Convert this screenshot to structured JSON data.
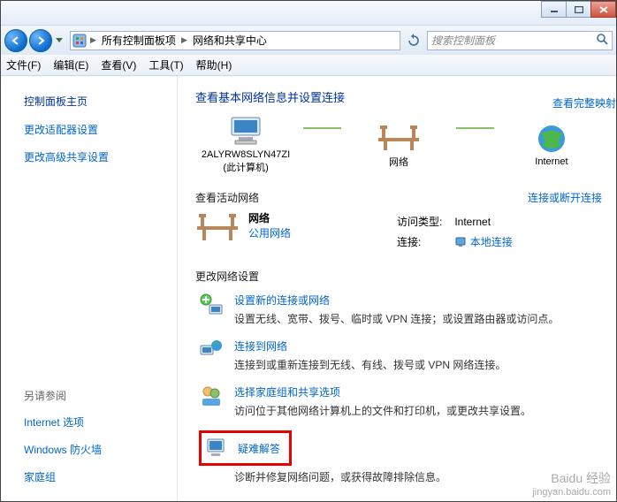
{
  "breadcrumb": {
    "item1": "所有控制面板项",
    "item2": "网络和共享中心"
  },
  "search": {
    "placeholder": "搜索控制面板"
  },
  "menu": {
    "file": "文件(F)",
    "edit": "编辑(E)",
    "view": "查看(V)",
    "tools": "工具(T)",
    "help": "帮助(H)"
  },
  "sidebar": {
    "home": "控制面板主页",
    "adapter": "更改适配器设置",
    "sharing": "更改高级共享设置",
    "seealso": "另请参阅",
    "inet": "Internet 选项",
    "fw": "Windows 防火墙",
    "hg": "家庭组"
  },
  "content": {
    "title": "查看基本网络信息并设置连接",
    "fullmap": "查看完整映射",
    "computer": "2ALYRW8SLYN47ZI",
    "thispc": "(此计算机)",
    "net": "网络",
    "internet": "Internet",
    "active_head": "查看活动网络",
    "disconnect": "连接或断开连接",
    "active_name": "网络",
    "active_type": "公用网络",
    "atype_label": "访问类型:",
    "atype_value": "Internet",
    "conn_label": "连接:",
    "conn_value": "本地连接",
    "change_head": "更改网络设置",
    "s1t": "设置新的连接或网络",
    "s1d": "设置无线、宽带、拨号、临时或 VPN 连接；或设置路由器或访问点。",
    "s2t": "连接到网络",
    "s2d": "连接到或重新连接到无线、有线、拨号或 VPN 网络连接。",
    "s3t": "选择家庭组和共享选项",
    "s3d": "访问位于其他网络计算机上的文件和打印机，或更改共享设置。",
    "s4t": "疑难解答",
    "s4d": "诊断并修复网络问题，或获得故障排除信息。"
  },
  "watermark": {
    "brand": "Baidu 经验",
    "url": "jingyan.baidu.com"
  }
}
